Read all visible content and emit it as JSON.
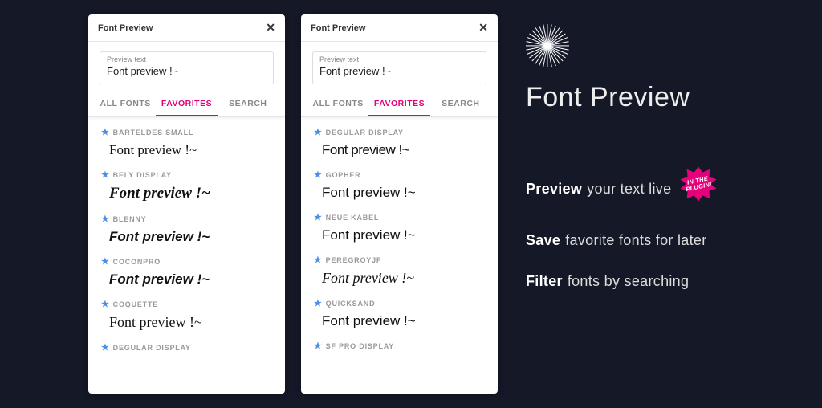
{
  "panel": {
    "title": "Font Preview",
    "preview_label": "Preview text",
    "preview_value": "Font preview !~",
    "tabs": {
      "all": "ALL FONTS",
      "fav": "FAVORITES",
      "search": "SEARCH"
    }
  },
  "panel1_fonts": [
    {
      "name": "BARTELDES SMALL",
      "sample": "Font preview !~"
    },
    {
      "name": "BELY DISPLAY",
      "sample": "Font preview !~"
    },
    {
      "name": "BLENNY",
      "sample": "Font preview !~"
    },
    {
      "name": "COCONPRO",
      "sample": "Font preview !~"
    },
    {
      "name": "COQUETTE",
      "sample": "Font preview !~"
    },
    {
      "name": "DEGULAR DISPLAY",
      "sample": ""
    }
  ],
  "panel2_fonts": [
    {
      "name": "DEGULAR DISPLAY",
      "sample": "Font preview !~"
    },
    {
      "name": "GOPHER",
      "sample": "Font preview !~"
    },
    {
      "name": "NEUE KABEL",
      "sample": "Font preview !~"
    },
    {
      "name": "PEREGROYJF",
      "sample": "Font preview !~"
    },
    {
      "name": "QUICKSAND",
      "sample": "Font preview !~"
    },
    {
      "name": "SF PRO DISPLAY",
      "sample": ""
    }
  ],
  "right": {
    "heading": "Font Preview",
    "feat1_b": "Preview",
    "feat1_r": "your text live",
    "badge": "IN THE PLUGIN!",
    "feat2_b": "Save",
    "feat2_r": "favorite fonts for later",
    "feat3_b": "Filter",
    "feat3_r": "fonts by searching"
  }
}
